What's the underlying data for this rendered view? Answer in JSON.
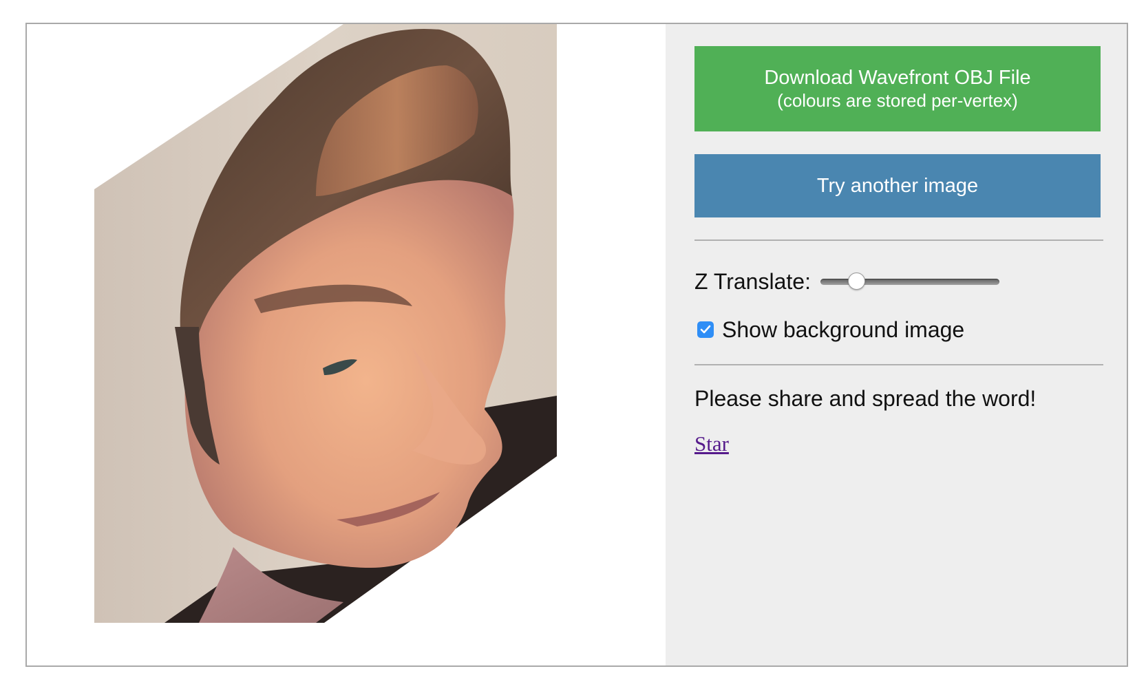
{
  "controls": {
    "download_line1": "Download Wavefront OBJ File",
    "download_line2": "(colours are stored per-vertex)",
    "another_label": "Try another image",
    "z_translate_label": "Z Translate:",
    "z_translate_value": 0.2,
    "show_background_label": "Show background image",
    "show_background_checked": true,
    "share_text": "Please share and spread the word!",
    "star_label": "Star"
  },
  "colors": {
    "download_button": "#50b056",
    "another_button": "#4a86b0",
    "panel_background": "#eeeeee",
    "checkbox_accent": "#2f8ef6",
    "link_visited": "#551a8b"
  },
  "viewport": {
    "content": "3d-face-mesh-render"
  }
}
